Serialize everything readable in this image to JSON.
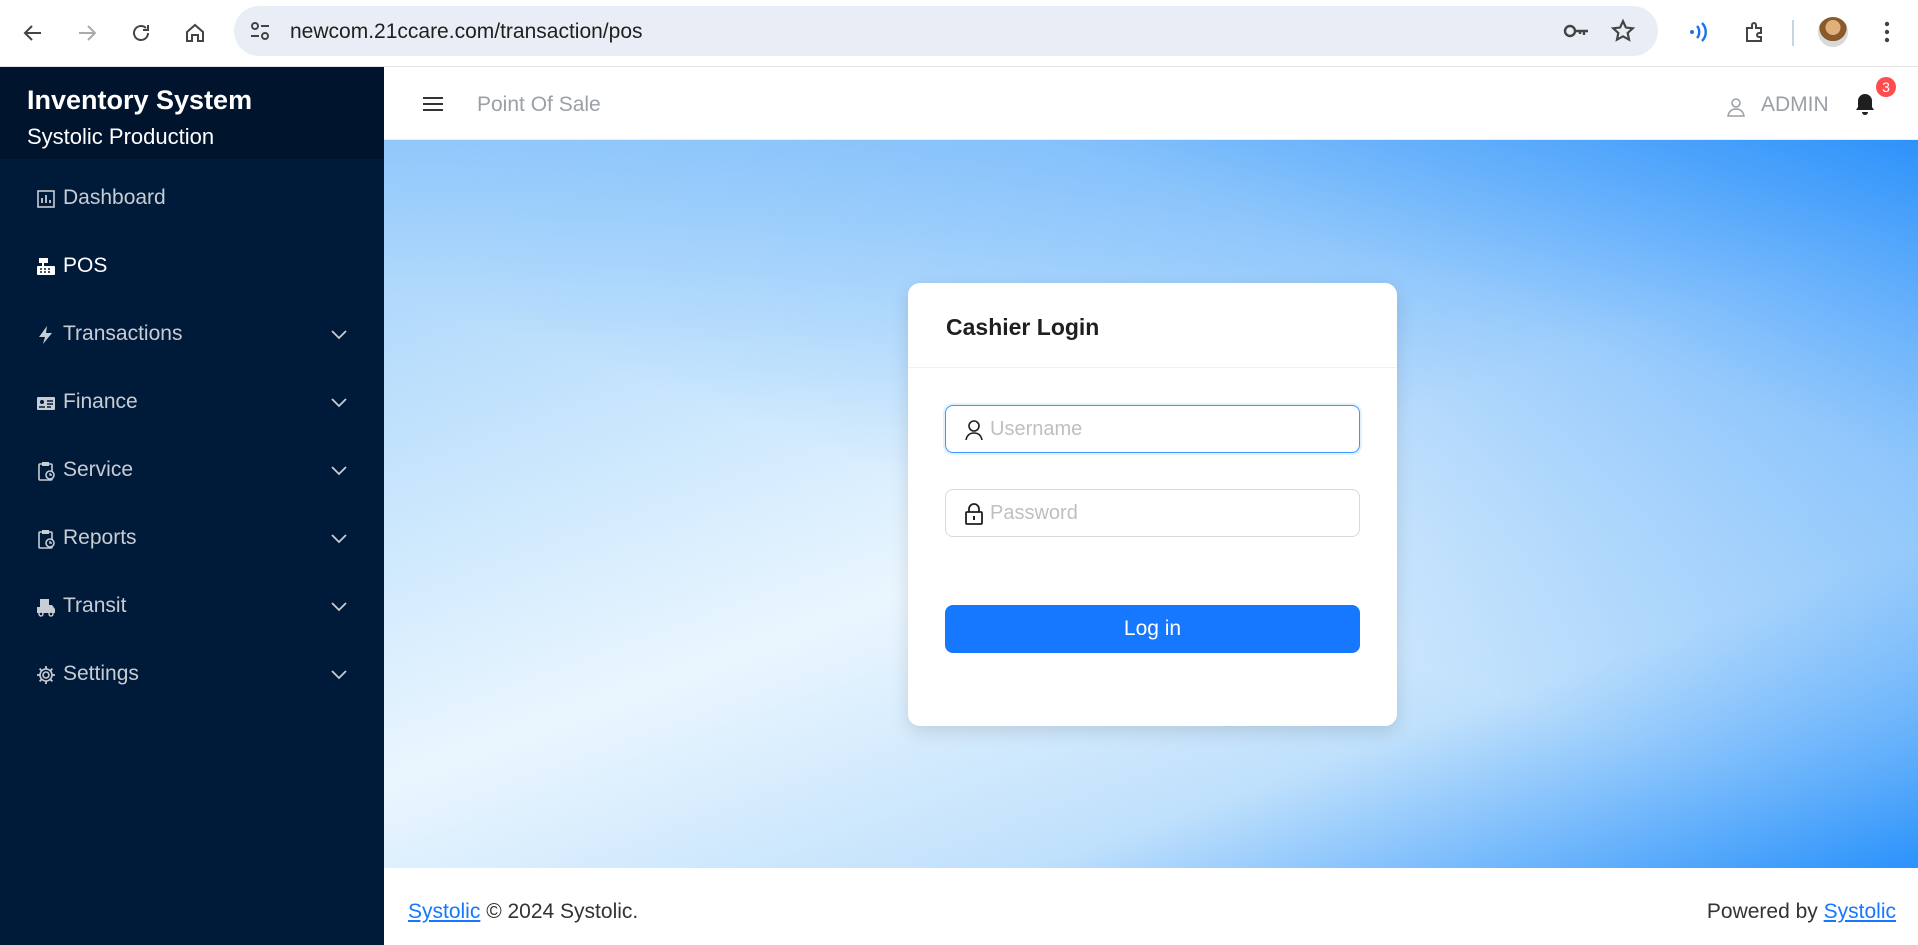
{
  "browser": {
    "url": "newcom.21ccare.com/transaction/pos"
  },
  "sidebar": {
    "title": "Inventory System",
    "subtitle": "Systolic Production",
    "items": [
      {
        "label": "Dashboard",
        "icon": "bar-chart-icon",
        "active": false,
        "expandable": false
      },
      {
        "label": "POS",
        "icon": "cash-register-icon",
        "active": true,
        "expandable": false
      },
      {
        "label": "Transactions",
        "icon": "lightning-icon",
        "active": false,
        "expandable": true
      },
      {
        "label": "Finance",
        "icon": "id-card-icon",
        "active": false,
        "expandable": true
      },
      {
        "label": "Service",
        "icon": "clipboard-icon",
        "active": false,
        "expandable": true
      },
      {
        "label": "Reports",
        "icon": "clipboard-icon",
        "active": false,
        "expandable": true
      },
      {
        "label": "Transit",
        "icon": "truck-icon",
        "active": false,
        "expandable": true
      },
      {
        "label": "Settings",
        "icon": "gear-icon",
        "active": false,
        "expandable": true
      }
    ]
  },
  "header": {
    "title": "Point Of Sale",
    "user": "ADMIN",
    "notification_count": "3"
  },
  "login": {
    "title": "Cashier Login",
    "username_placeholder": "Username",
    "password_placeholder": "Password",
    "button_label": "Log in"
  },
  "footer": {
    "left_link": "Systolic",
    "left_text": " © 2024 Systolic.",
    "right_text": "Powered by ",
    "right_link": "Systolic"
  },
  "colors": {
    "sidebar_bg": "#001a39",
    "primary": "#1677ff",
    "badge": "#ff4d4f"
  }
}
